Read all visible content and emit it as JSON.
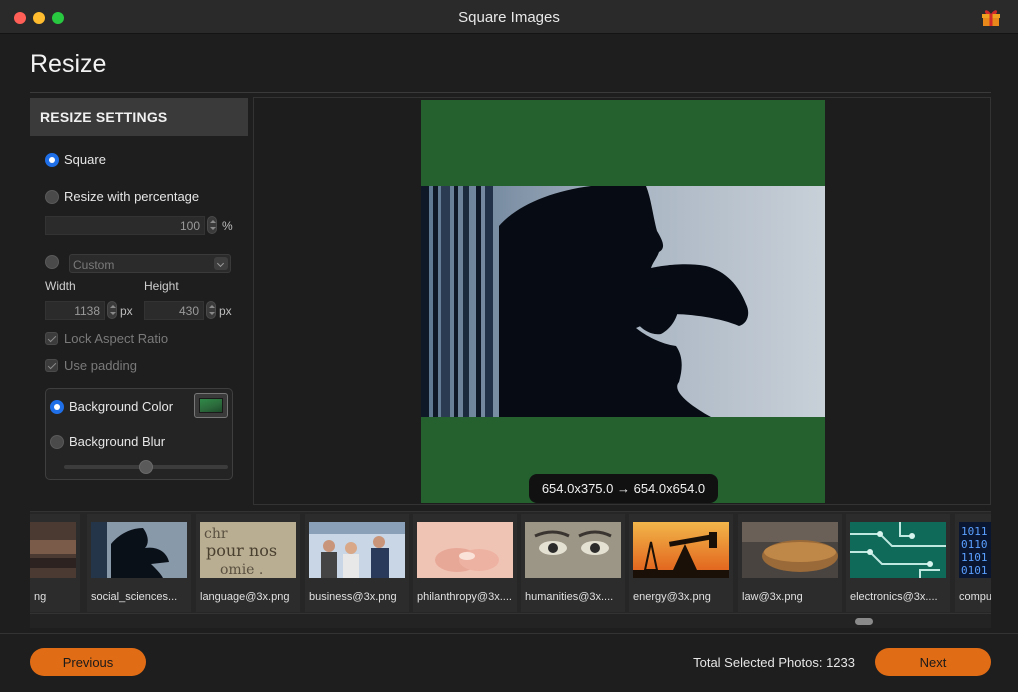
{
  "window": {
    "title": "Square Images"
  },
  "page": {
    "title": "Resize"
  },
  "settings": {
    "header": "RESIZE SETTINGS",
    "square_label": "Square",
    "percentage_label": "Resize with percentage",
    "percentage_value": "100",
    "percentage_unit": "%",
    "custom_select": "Custom",
    "width_label": "Width",
    "height_label": "Height",
    "width_value": "1138",
    "height_value": "430",
    "px_unit": "px",
    "lock_aspect_label": "Lock Aspect Ratio",
    "use_padding_label": "Use padding",
    "background_color_label": "Background Color",
    "background_blur_label": "Background Blur",
    "selected_mode": "square",
    "selected_background": "color",
    "background_color": "#2d6b3a"
  },
  "preview": {
    "size_text": "654.0x375.0 → 654.0x654.0",
    "pad_color": "#24612f"
  },
  "thumbnails": [
    {
      "caption": "ng",
      "icon": "rusty-pipe-image"
    },
    {
      "caption": "social_sciences...",
      "icon": "silhouette-image"
    },
    {
      "caption": "language@3x.png",
      "icon": "text-page-image"
    },
    {
      "caption": "business@3x.png",
      "icon": "business-people-image"
    },
    {
      "caption": "philanthropy@3x....",
      "icon": "open-hands-image"
    },
    {
      "caption": "humanities@3x....",
      "icon": "eyes-engraving-image"
    },
    {
      "caption": "energy@3x.png",
      "icon": "oil-pump-image"
    },
    {
      "caption": "law@3x.png",
      "icon": "gavel-image"
    },
    {
      "caption": "electronics@3x....",
      "icon": "circuit-board-image"
    },
    {
      "caption": "compu",
      "icon": "binary-code-image"
    }
  ],
  "footer": {
    "previous_label": "Previous",
    "next_label": "Next",
    "total_text": "Total Selected Photos: 1233"
  },
  "colors": {
    "accent": "#e06c16",
    "radio_selected": "#1f6fe8"
  }
}
